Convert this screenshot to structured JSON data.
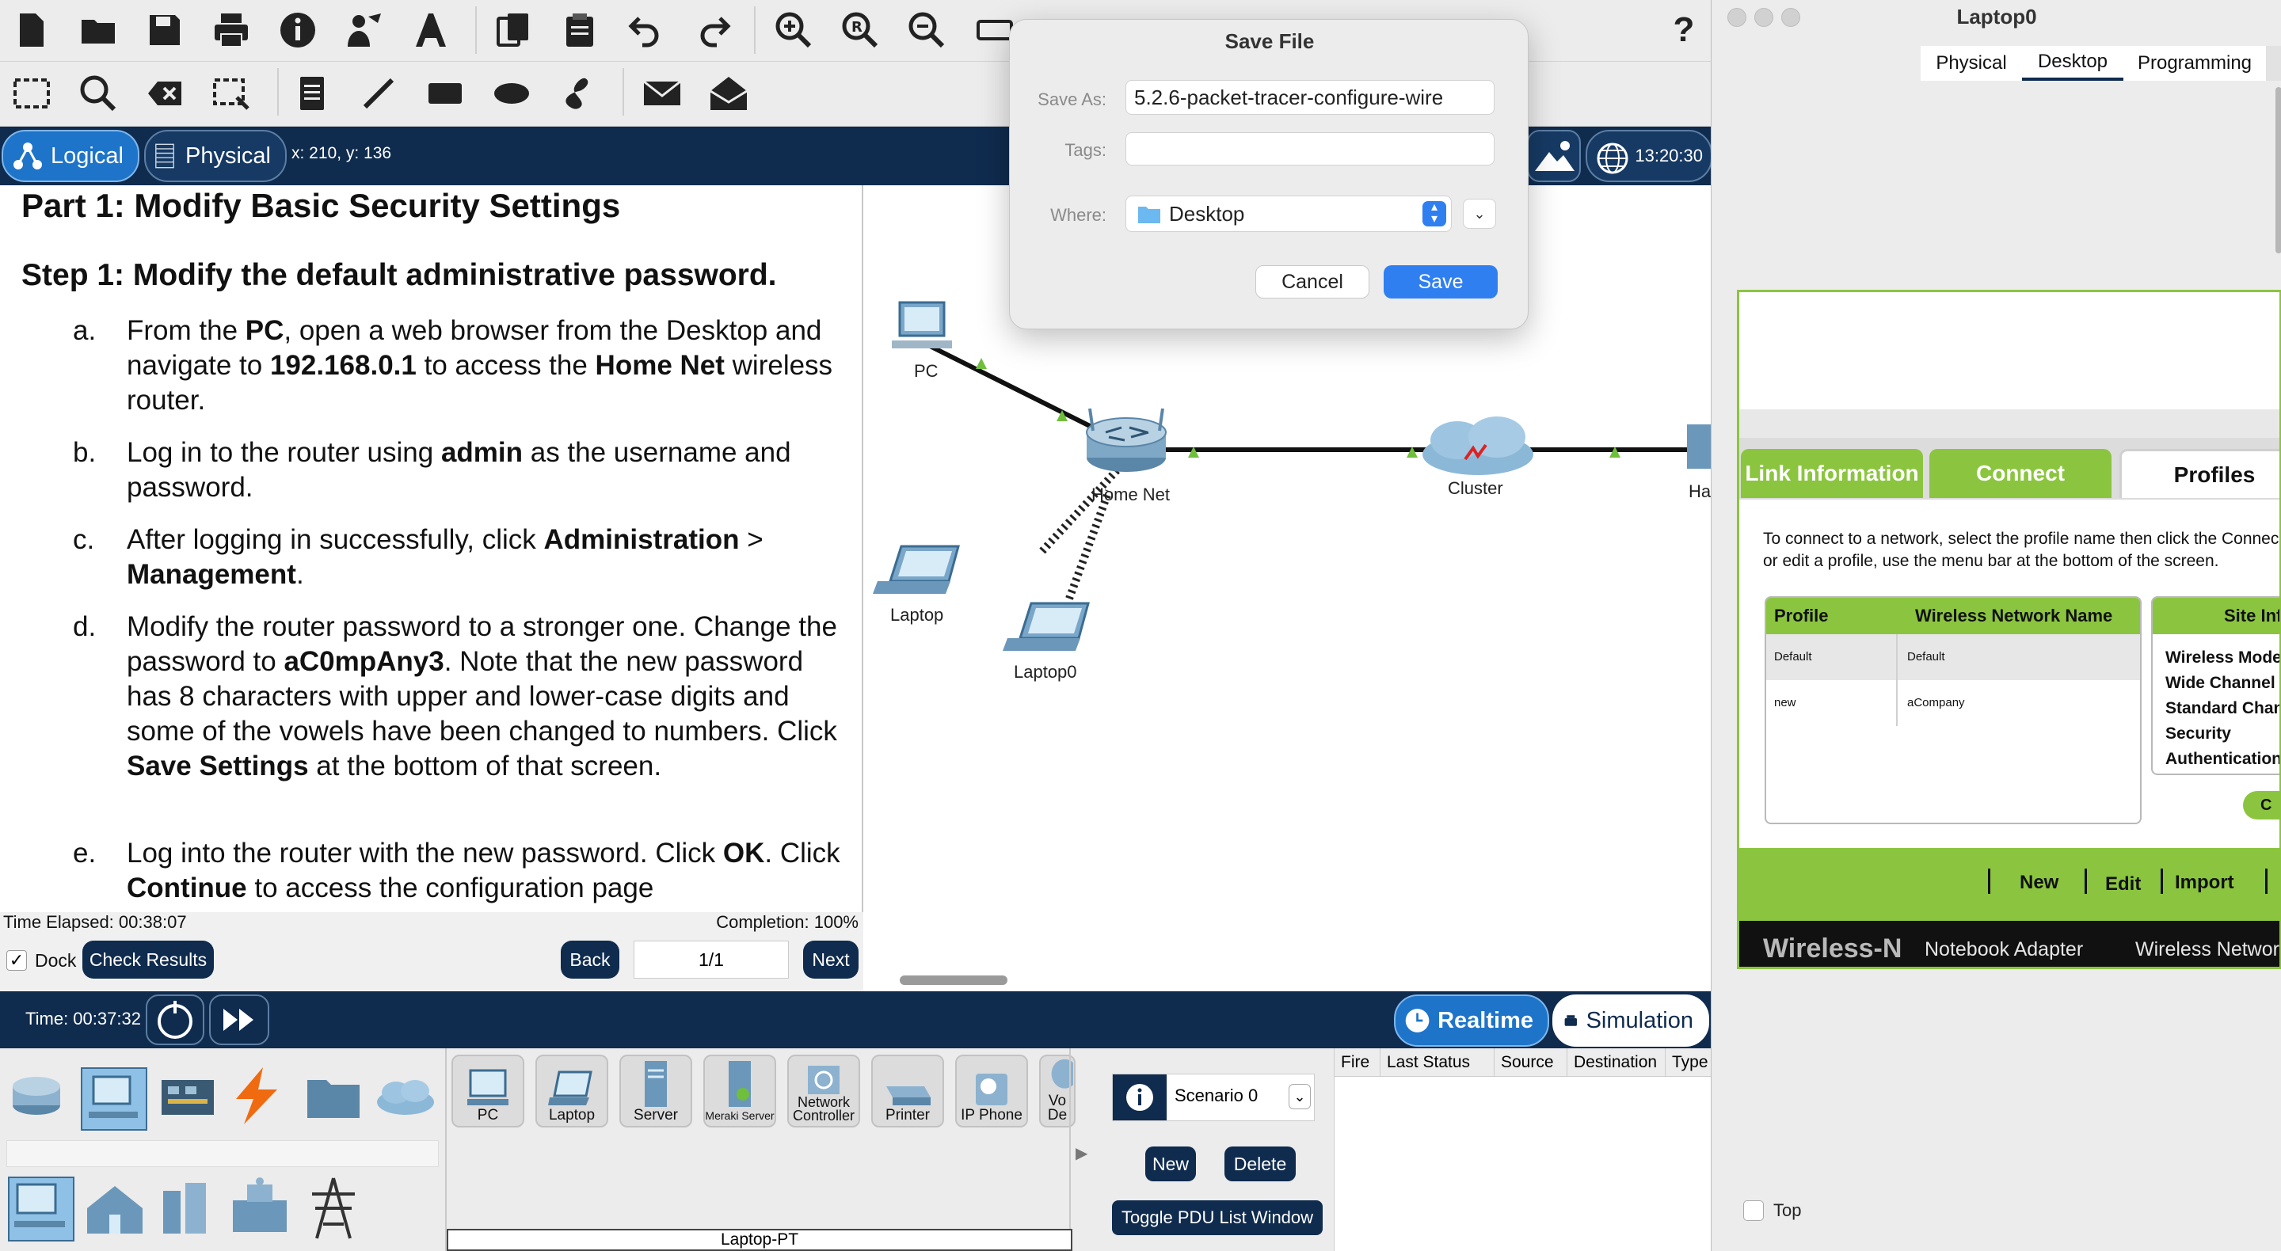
{
  "toolbar": {
    "row1_icons": [
      "new-file-icon",
      "open-folder-icon",
      "save-icon",
      "print-icon",
      "info-icon",
      "activity-wizard-icon",
      "font-icon",
      "copy-icon",
      "paste-icon",
      "undo-icon",
      "redo-icon",
      "zoom-in-icon",
      "zoom-reset-icon",
      "zoom-out-icon",
      "help-icon"
    ],
    "row2_icons": [
      "select-icon",
      "inspect-icon",
      "delete-icon",
      "resize-icon",
      "note-icon",
      "line-icon",
      "rectangle-icon",
      "ellipse-icon",
      "freeform-icon",
      "simple-pdu-icon",
      "complex-pdu-icon"
    ],
    "help_label": "?"
  },
  "band": {
    "logical_label": "Logical",
    "physical_label": "Physical",
    "coords": "x: 210, y: 136",
    "clock": "13:20:30"
  },
  "instructions": {
    "part_title": "Part 1: Modify Basic Security Settings",
    "step_title": "Step 1: Modify the default administrative password.",
    "steps": [
      {
        "letter": "a.",
        "parts": [
          "From the ",
          "PC",
          ", open a web browser from the Desktop and navigate to ",
          "192.168.0.1",
          " to access the ",
          "Home Net",
          " wireless router."
        ]
      },
      {
        "letter": "b.",
        "parts": [
          "Log in to the router using ",
          "admin",
          " as the username and password."
        ]
      },
      {
        "letter": "c.",
        "parts": [
          "After logging in successfully, click ",
          "Administration",
          " > ",
          "Management",
          "."
        ]
      },
      {
        "letter": "d.",
        "parts": [
          "Modify the router password to a stronger one. Change the password to ",
          "aC0mpAny3",
          ". Note that the new password has 8 characters with upper and lower-case digits and some of the vowels have been changed to numbers. Click ",
          "Save Settings",
          " at the bottom of that screen."
        ]
      },
      {
        "letter": "e.",
        "parts": [
          "Log into the router with the new password. Click ",
          "OK",
          ". Click ",
          "Continue",
          " to access the configuration page"
        ]
      }
    ],
    "time_elapsed": "Time Elapsed: 00:38:07",
    "completion": "Completion: 100%",
    "dock_label": "Dock",
    "check_results": "Check Results",
    "back": "Back",
    "page": "1/1",
    "next": "Next"
  },
  "workspace": {
    "devices": {
      "pc": "PC",
      "router": "Home Net",
      "cloud": "Cluster",
      "laptop": "Laptop",
      "laptop0": "Laptop0",
      "partial": "Ha"
    }
  },
  "dialog": {
    "title": "Save File",
    "save_as_label": "Save As:",
    "save_as_value": "5.2.6-packet-tracer-configure-wire",
    "tags_label": "Tags:",
    "tags_value": "",
    "where_label": "Where:",
    "where_value": "Desktop",
    "cancel": "Cancel",
    "save": "Save"
  },
  "bottom": {
    "time": "Time: 00:37:32",
    "realtime": "Realtime",
    "simulation": "Simulation",
    "device_tiles": [
      "PC",
      "Laptop",
      "Server",
      "Meraki Server",
      "Network Controller",
      "Printer",
      "IP Phone",
      "Vo De"
    ],
    "device_name": "Laptop-PT",
    "scenario": "Scenario 0",
    "new": "New",
    "delete": "Delete",
    "toggle_pdu": "Toggle PDU List Window",
    "pdu_columns": [
      "Fire",
      "Last Status",
      "Source",
      "Destination",
      "Type"
    ]
  },
  "laptop_window": {
    "title": "Laptop0",
    "tabs": [
      "Physical",
      "Desktop",
      "Programming"
    ],
    "active_tab": "Desktop",
    "wtabs": [
      "Link Information",
      "Connect",
      "Profiles"
    ],
    "help_text_1": "To connect to a network, select the profile name then click the Connec",
    "help_text_2": "or edit a profile, use the menu bar at the bottom of the screen.",
    "table_headers": [
      "Profile",
      "Wireless Network Name"
    ],
    "rows": [
      {
        "profile": "Default",
        "ssid": "Default"
      },
      {
        "profile": "new",
        "ssid": "aCompany"
      }
    ],
    "site_info_header": "Site Inf",
    "site_info": [
      "Wireless Mode",
      "Wide Channel",
      "Standard Chan",
      "Security",
      "Authentication"
    ],
    "site_btn": "C",
    "menu": [
      "New",
      "Edit",
      "Import"
    ],
    "brand": "Wireless-N",
    "brand_sub": "Notebook Adapter",
    "brand_right": "Wireless Networ",
    "top_label": "Top"
  },
  "colors": {
    "navy": "#0f2b4e",
    "accent_blue": "#1e74c8",
    "linksys_green": "#8bc53f",
    "dialog_save": "#2f7ff0"
  }
}
